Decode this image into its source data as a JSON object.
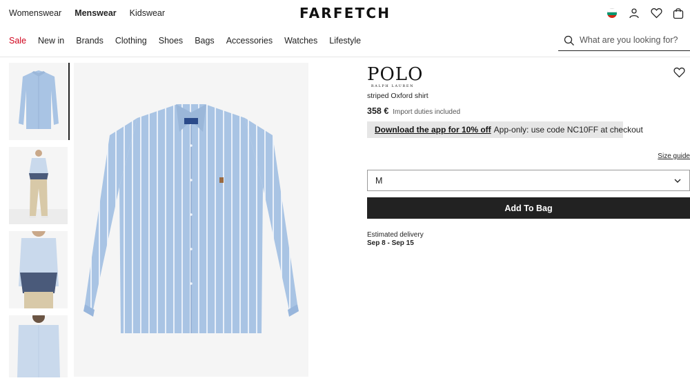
{
  "header": {
    "top_nav": [
      "Womenswear",
      "Menswear",
      "Kidswear"
    ],
    "active_top": "Menswear",
    "logo": "FARFETCH",
    "icons": [
      "flag-icon",
      "account-icon",
      "wishlist-icon",
      "bag-icon"
    ]
  },
  "nav": {
    "sale": "Sale",
    "items": [
      "New in",
      "Brands",
      "Clothing",
      "Shoes",
      "Bags",
      "Accessories",
      "Watches",
      "Lifestyle"
    ]
  },
  "search": {
    "placeholder": "What are you looking for?"
  },
  "product": {
    "brand": "POLO",
    "brand_sub": "RALPH LAUREN",
    "name": "striped Oxford shirt",
    "price": "358 €",
    "duties": "Import duties included"
  },
  "promo": {
    "link": "Download the app for 10% off",
    "text": "App-only: use code NC10FF at checkout"
  },
  "size_guide": "Size guide",
  "size_select": {
    "value": "M"
  },
  "add_to_bag": "Add To Bag",
  "delivery": {
    "label": "Estimated delivery",
    "date": "Sep 8 - Sep 15"
  },
  "colors": {
    "sale": "#d0021b",
    "button": "#222222",
    "promo_bg": "#e6e6e6",
    "shirt": "#a9c4e4"
  }
}
